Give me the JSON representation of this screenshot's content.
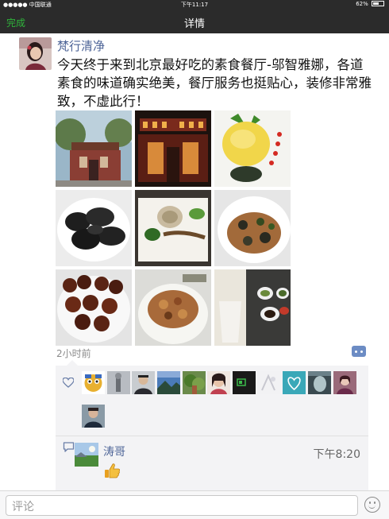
{
  "status_bar": {
    "carrier": "●●●●● 中国联通",
    "time": "下午11:17",
    "battery": "62%",
    "battery_level": 0.62
  },
  "nav": {
    "back_label": "完成",
    "title": "详情"
  },
  "post": {
    "author": "梵行清净",
    "text": "今天终于来到北京最好吃的素食餐厅-邬智雅娜，各道素食的味道确实绝美，餐厅服务也挺贴心，装修非常雅致，不虚此行！",
    "time_ago": "2小时前",
    "photos": [
      "restaurant-exterior-photo",
      "restaurant-night-facade-photo",
      "yellow-flower-dish-photo",
      "dark-dumplings-photo",
      "rice-and-green-sauce-plate-photo",
      "stir-fried-mushrooms-photo",
      "glazed-rolls-photo",
      "fried-crispy-dish-photo",
      "table-with-sauces-photo"
    ]
  },
  "likes": {
    "icon": "heart-icon",
    "likers": [
      "liker-1",
      "liker-2",
      "liker-3",
      "liker-4",
      "liker-5",
      "liker-6",
      "liker-7",
      "liker-8",
      "liker-9",
      "liker-10",
      "liker-11",
      "liker-12"
    ]
  },
  "comment": {
    "icon": "comment-bubble-icon",
    "author": "涛哥",
    "time": "下午8:20",
    "emoji": "thumbs-up-icon"
  },
  "bottom_bar": {
    "placeholder": "评论",
    "emoji_icon": "smiley-icon"
  },
  "colors": {
    "nav_bg": "#2b2b2b",
    "accent_green": "#2fb53b",
    "name_blue": "#4d6497",
    "box_bg": "#f3f3f5"
  }
}
